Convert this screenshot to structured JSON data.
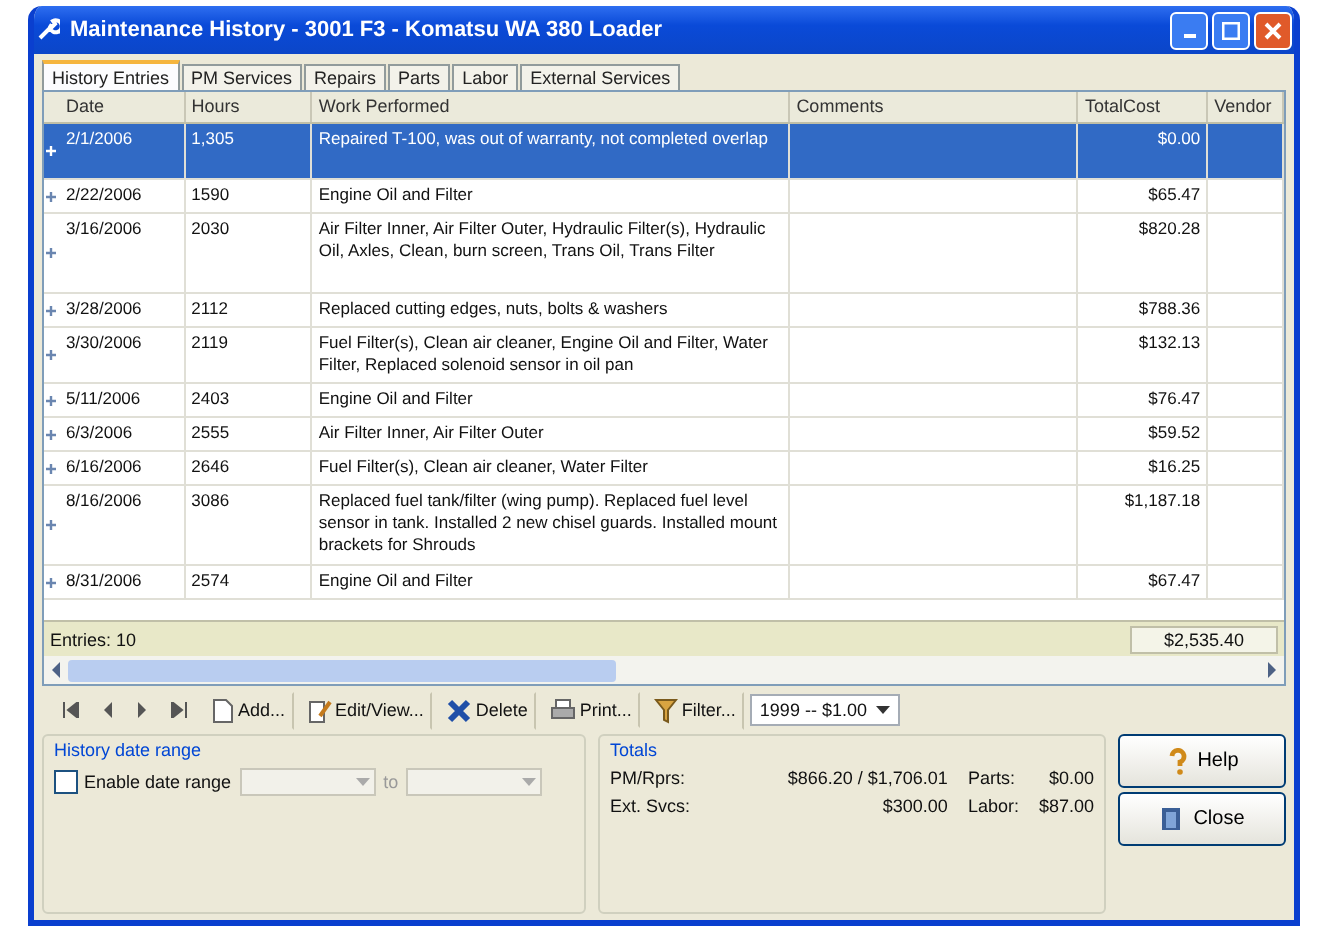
{
  "window": {
    "title": "Maintenance History - 3001 F3 - Komatsu WA 380 Loader"
  },
  "tabs": [
    {
      "label": "History Entries",
      "selected": true
    },
    {
      "label": "PM Services",
      "selected": false
    },
    {
      "label": "Repairs",
      "selected": false
    },
    {
      "label": "Parts",
      "selected": false
    },
    {
      "label": "Labor",
      "selected": false
    },
    {
      "label": "External Services",
      "selected": false
    }
  ],
  "table": {
    "columns": [
      "Date",
      "Hours",
      "Work Performed",
      "Comments",
      "TotalCost",
      "Vendor"
    ],
    "rows": [
      {
        "date": "2/1/2006",
        "hours": "1,305",
        "work": "Repaired T-100, was out of warranty, not completed overlap",
        "total": "$0.00",
        "selected": true,
        "expanded": false
      },
      {
        "date": "2/22/2006",
        "hours": "1590",
        "work": "Engine Oil and Filter",
        "total": "$65.47",
        "selected": false,
        "expanded": false
      },
      {
        "date": "3/16/2006",
        "hours": "2030",
        "work": "Air Filter Inner, Air Filter Outer, Hydraulic Filter(s), Hydraulic Oil, Axles, Clean, burn screen, Trans Oil, Trans Filter",
        "total": "$820.28",
        "selected": false,
        "expanded": false
      },
      {
        "date": "3/28/2006",
        "hours": "2112",
        "work": "Replaced cutting edges, nuts, bolts & washers",
        "total": "$788.36",
        "selected": false,
        "expanded": false
      },
      {
        "date": "3/30/2006",
        "hours": "2119",
        "work": "Fuel Filter(s), Clean air cleaner, Engine Oil and Filter, Water Filter, Replaced solenoid sensor in oil pan",
        "total": "$132.13",
        "selected": false,
        "expanded": false
      },
      {
        "date": "5/11/2006",
        "hours": "2403",
        "work": "Engine Oil and Filter",
        "total": "$76.47",
        "selected": false,
        "expanded": false
      },
      {
        "date": "6/3/2006",
        "hours": "2555",
        "work": "Air Filter Inner, Air Filter Outer",
        "total": "$59.52",
        "selected": false,
        "expanded": false
      },
      {
        "date": "6/16/2006",
        "hours": "2646",
        "work": "Fuel Filter(s), Clean air cleaner, Water Filter",
        "total": "$16.25",
        "selected": false,
        "expanded": false
      },
      {
        "date": "8/16/2006",
        "hours": "3086",
        "work": "Replaced fuel tank/filter (wing pump). Replaced fuel level sensor in tank. Installed 2 new chisel guards. Installed mount brackets for Shrouds",
        "total": "$1,187.18",
        "selected": false,
        "expanded": false
      },
      {
        "date": "8/31/2006",
        "hours": "2574",
        "work": "Engine Oil and Filter",
        "total": "$67.47",
        "selected": false,
        "expanded": false
      }
    ],
    "footer": {
      "count": "Entries: 10",
      "total": "$2,535.40"
    }
  },
  "toolbar": {
    "buttons": [
      {
        "label": "Add...",
        "kind": "add"
      },
      {
        "label": "Edit/View...",
        "kind": "edit"
      },
      {
        "label": "Delete",
        "kind": "delete"
      },
      {
        "label": "Print...",
        "kind": "print"
      },
      {
        "label": "Filter...",
        "kind": "filter"
      }
    ],
    "dropdown": "1999 -- $1.00"
  },
  "date_range": {
    "title": "History date range",
    "checkbox": {
      "label": "Enable date range",
      "checked": false
    },
    "to": "to",
    "disabled": true
  },
  "totals": {
    "title": "Totals",
    "items": [
      {
        "label": "PM/Rprs:",
        "value": "$866.20 / $1,706.01"
      },
      {
        "label": "Parts:",
        "value": "$0.00"
      },
      {
        "label": "Ext. Svcs:",
        "value": "$300.00"
      },
      {
        "label": "Labor:",
        "value": "$87.00"
      }
    ]
  },
  "side_buttons": [
    {
      "label": "Help",
      "kind": "help"
    },
    {
      "label": "Close",
      "kind": "close"
    }
  ]
}
